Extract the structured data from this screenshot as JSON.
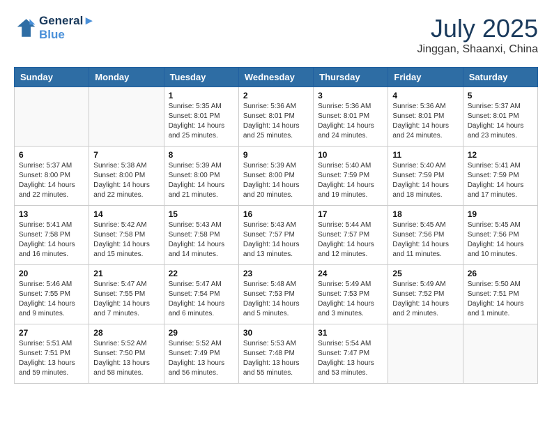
{
  "header": {
    "logo_line1": "General",
    "logo_line2": "Blue",
    "month_year": "July 2025",
    "location": "Jinggan, Shaanxi, China"
  },
  "days_of_week": [
    "Sunday",
    "Monday",
    "Tuesday",
    "Wednesday",
    "Thursday",
    "Friday",
    "Saturday"
  ],
  "weeks": [
    [
      {
        "day": "",
        "info": ""
      },
      {
        "day": "",
        "info": ""
      },
      {
        "day": "1",
        "info": "Sunrise: 5:35 AM\nSunset: 8:01 PM\nDaylight: 14 hours and 25 minutes."
      },
      {
        "day": "2",
        "info": "Sunrise: 5:36 AM\nSunset: 8:01 PM\nDaylight: 14 hours and 25 minutes."
      },
      {
        "day": "3",
        "info": "Sunrise: 5:36 AM\nSunset: 8:01 PM\nDaylight: 14 hours and 24 minutes."
      },
      {
        "day": "4",
        "info": "Sunrise: 5:36 AM\nSunset: 8:01 PM\nDaylight: 14 hours and 24 minutes."
      },
      {
        "day": "5",
        "info": "Sunrise: 5:37 AM\nSunset: 8:01 PM\nDaylight: 14 hours and 23 minutes."
      }
    ],
    [
      {
        "day": "6",
        "info": "Sunrise: 5:37 AM\nSunset: 8:00 PM\nDaylight: 14 hours and 22 minutes."
      },
      {
        "day": "7",
        "info": "Sunrise: 5:38 AM\nSunset: 8:00 PM\nDaylight: 14 hours and 22 minutes."
      },
      {
        "day": "8",
        "info": "Sunrise: 5:39 AM\nSunset: 8:00 PM\nDaylight: 14 hours and 21 minutes."
      },
      {
        "day": "9",
        "info": "Sunrise: 5:39 AM\nSunset: 8:00 PM\nDaylight: 14 hours and 20 minutes."
      },
      {
        "day": "10",
        "info": "Sunrise: 5:40 AM\nSunset: 7:59 PM\nDaylight: 14 hours and 19 minutes."
      },
      {
        "day": "11",
        "info": "Sunrise: 5:40 AM\nSunset: 7:59 PM\nDaylight: 14 hours and 18 minutes."
      },
      {
        "day": "12",
        "info": "Sunrise: 5:41 AM\nSunset: 7:59 PM\nDaylight: 14 hours and 17 minutes."
      }
    ],
    [
      {
        "day": "13",
        "info": "Sunrise: 5:41 AM\nSunset: 7:58 PM\nDaylight: 14 hours and 16 minutes."
      },
      {
        "day": "14",
        "info": "Sunrise: 5:42 AM\nSunset: 7:58 PM\nDaylight: 14 hours and 15 minutes."
      },
      {
        "day": "15",
        "info": "Sunrise: 5:43 AM\nSunset: 7:58 PM\nDaylight: 14 hours and 14 minutes."
      },
      {
        "day": "16",
        "info": "Sunrise: 5:43 AM\nSunset: 7:57 PM\nDaylight: 14 hours and 13 minutes."
      },
      {
        "day": "17",
        "info": "Sunrise: 5:44 AM\nSunset: 7:57 PM\nDaylight: 14 hours and 12 minutes."
      },
      {
        "day": "18",
        "info": "Sunrise: 5:45 AM\nSunset: 7:56 PM\nDaylight: 14 hours and 11 minutes."
      },
      {
        "day": "19",
        "info": "Sunrise: 5:45 AM\nSunset: 7:56 PM\nDaylight: 14 hours and 10 minutes."
      }
    ],
    [
      {
        "day": "20",
        "info": "Sunrise: 5:46 AM\nSunset: 7:55 PM\nDaylight: 14 hours and 9 minutes."
      },
      {
        "day": "21",
        "info": "Sunrise: 5:47 AM\nSunset: 7:55 PM\nDaylight: 14 hours and 7 minutes."
      },
      {
        "day": "22",
        "info": "Sunrise: 5:47 AM\nSunset: 7:54 PM\nDaylight: 14 hours and 6 minutes."
      },
      {
        "day": "23",
        "info": "Sunrise: 5:48 AM\nSunset: 7:53 PM\nDaylight: 14 hours and 5 minutes."
      },
      {
        "day": "24",
        "info": "Sunrise: 5:49 AM\nSunset: 7:53 PM\nDaylight: 14 hours and 3 minutes."
      },
      {
        "day": "25",
        "info": "Sunrise: 5:49 AM\nSunset: 7:52 PM\nDaylight: 14 hours and 2 minutes."
      },
      {
        "day": "26",
        "info": "Sunrise: 5:50 AM\nSunset: 7:51 PM\nDaylight: 14 hours and 1 minute."
      }
    ],
    [
      {
        "day": "27",
        "info": "Sunrise: 5:51 AM\nSunset: 7:51 PM\nDaylight: 13 hours and 59 minutes."
      },
      {
        "day": "28",
        "info": "Sunrise: 5:52 AM\nSunset: 7:50 PM\nDaylight: 13 hours and 58 minutes."
      },
      {
        "day": "29",
        "info": "Sunrise: 5:52 AM\nSunset: 7:49 PM\nDaylight: 13 hours and 56 minutes."
      },
      {
        "day": "30",
        "info": "Sunrise: 5:53 AM\nSunset: 7:48 PM\nDaylight: 13 hours and 55 minutes."
      },
      {
        "day": "31",
        "info": "Sunrise: 5:54 AM\nSunset: 7:47 PM\nDaylight: 13 hours and 53 minutes."
      },
      {
        "day": "",
        "info": ""
      },
      {
        "day": "",
        "info": ""
      }
    ]
  ]
}
